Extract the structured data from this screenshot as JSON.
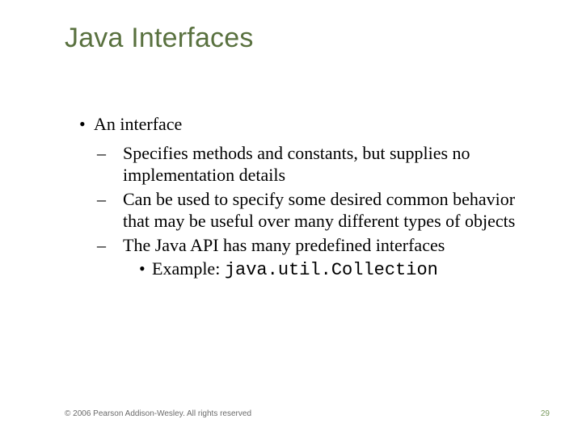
{
  "title": "Java Interfaces",
  "bullets": {
    "l1": "An interface",
    "l2a": "Specifies methods and constants, but supplies no implementation details",
    "l2b": "Can be used to specify some desired common behavior that may be useful over many different types of objects",
    "l2c": "The Java API has many predefined interfaces",
    "l3_prefix": "Example: ",
    "l3_code": "java.util.Collection"
  },
  "footer": {
    "copyright": "© 2006 Pearson Addison-Wesley. All rights reserved",
    "page": "29"
  }
}
